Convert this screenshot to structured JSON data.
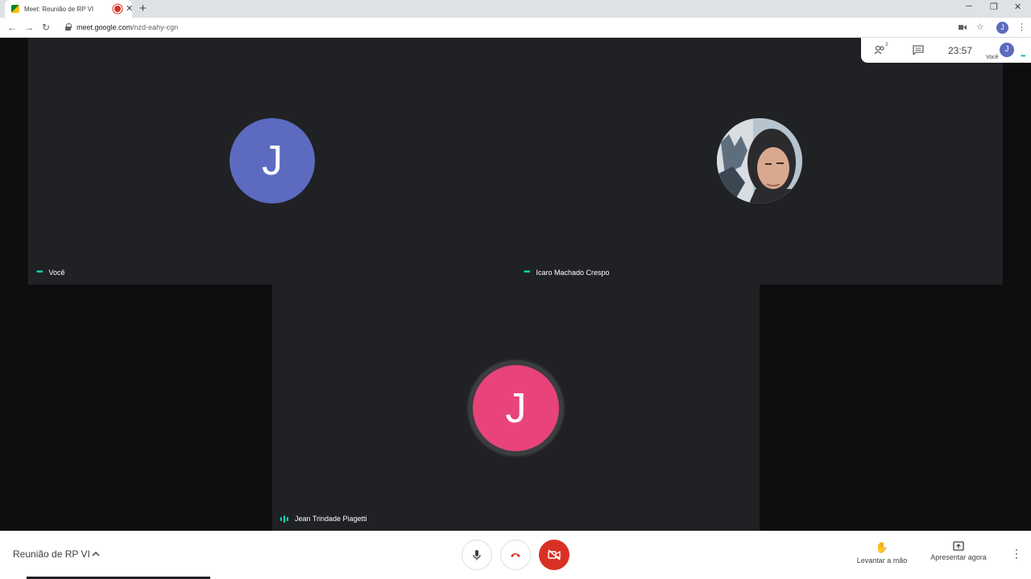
{
  "browser": {
    "tab_title": "Meet: Reunião de RP VI",
    "tab_close": "✕",
    "new_tab": "+",
    "url_host": "meet.google.com",
    "url_path": "/nzd-eahy-cgn",
    "profile_initial": "J",
    "window_controls": {
      "minimize": "─",
      "maximize": "❐",
      "close": "✕"
    }
  },
  "info_panel": {
    "participants_count": "3",
    "clock": "23:57",
    "self_initial": "J",
    "self_label": "Você"
  },
  "tiles": {
    "you": {
      "name": "Você",
      "initial": "J",
      "color": "#5c6bc0"
    },
    "icaro": {
      "name": "Icaro Machado Crespo"
    },
    "jean": {
      "name": "Jean Trindade Piagetti",
      "initial": "J",
      "color": "#e8447a"
    }
  },
  "bottom_bar": {
    "meeting_title": "Reunião de RP VI",
    "raise_hand": "Levantar a mão",
    "present_now": "Apresentar agora"
  },
  "colors": {
    "stage_bg": "#202124",
    "speaking_indicator": "#00e5b8",
    "hangup": "#d93025"
  }
}
